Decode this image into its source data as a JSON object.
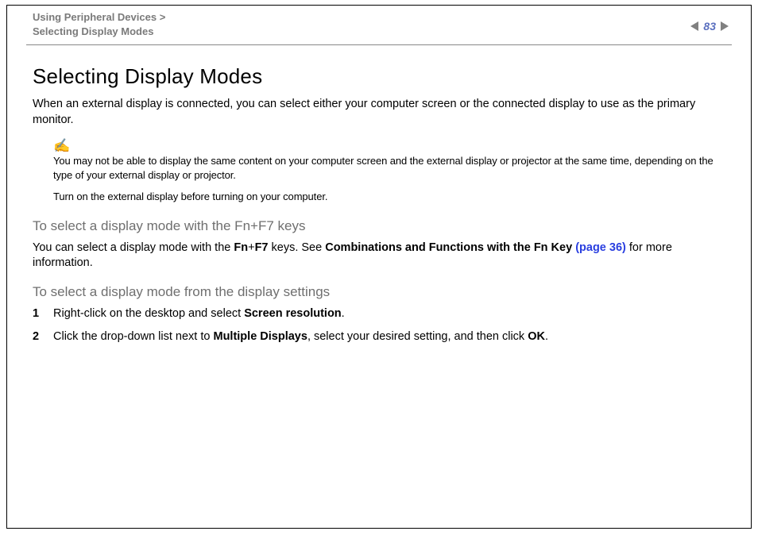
{
  "header": {
    "breadcrumb_line1": "Using Peripheral Devices",
    "breadcrumb_line2": "Selecting Display Modes",
    "page_number": "83"
  },
  "main": {
    "title": "Selecting Display Modes",
    "intro": "When an external display is connected, you can select either your computer screen or the connected display to use as the primary monitor.",
    "note1": "You may not be able to display the same content on your computer screen and the external display or projector at the same time, depending on the type of your external display or projector.",
    "note2": "Turn on the external display before turning on your computer.",
    "sub1": "To select a display mode with the Fn+F7 keys",
    "para1_a": "You can select a display mode with the ",
    "para1_fn": "Fn",
    "para1_plus": "+",
    "para1_f7": "F7",
    "para1_b": " keys. See ",
    "para1_comb": "Combinations and Functions with the Fn Key ",
    "para1_link": "(page 36)",
    "para1_c": " for more information.",
    "sub2": "To select a display mode from the display settings",
    "step1_a": "Right-click on the desktop and select ",
    "step1_b": "Screen resolution",
    "step1_c": ".",
    "step2_a": "Click the drop-down list next to ",
    "step2_b": "Multiple Displays",
    "step2_c": ", select your desired setting, and then click ",
    "step2_d": "OK",
    "step2_e": "."
  }
}
